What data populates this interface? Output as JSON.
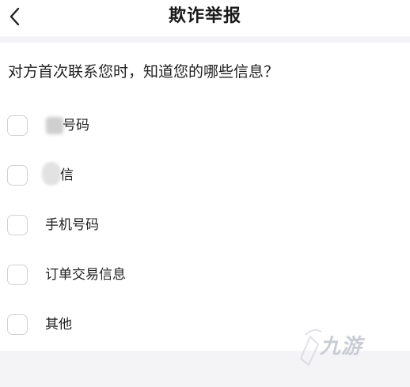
{
  "header": {
    "title": "欺诈举报",
    "back_icon": "chevron-left-icon"
  },
  "question": "对方首次联系您时，知道您的哪些信息？",
  "options": [
    {
      "label": "号码"
    },
    {
      "label": "信"
    },
    {
      "label": "手机号码"
    },
    {
      "label": "订单交易信息"
    },
    {
      "label": "其他"
    }
  ],
  "watermark": {
    "text": "九游"
  }
}
